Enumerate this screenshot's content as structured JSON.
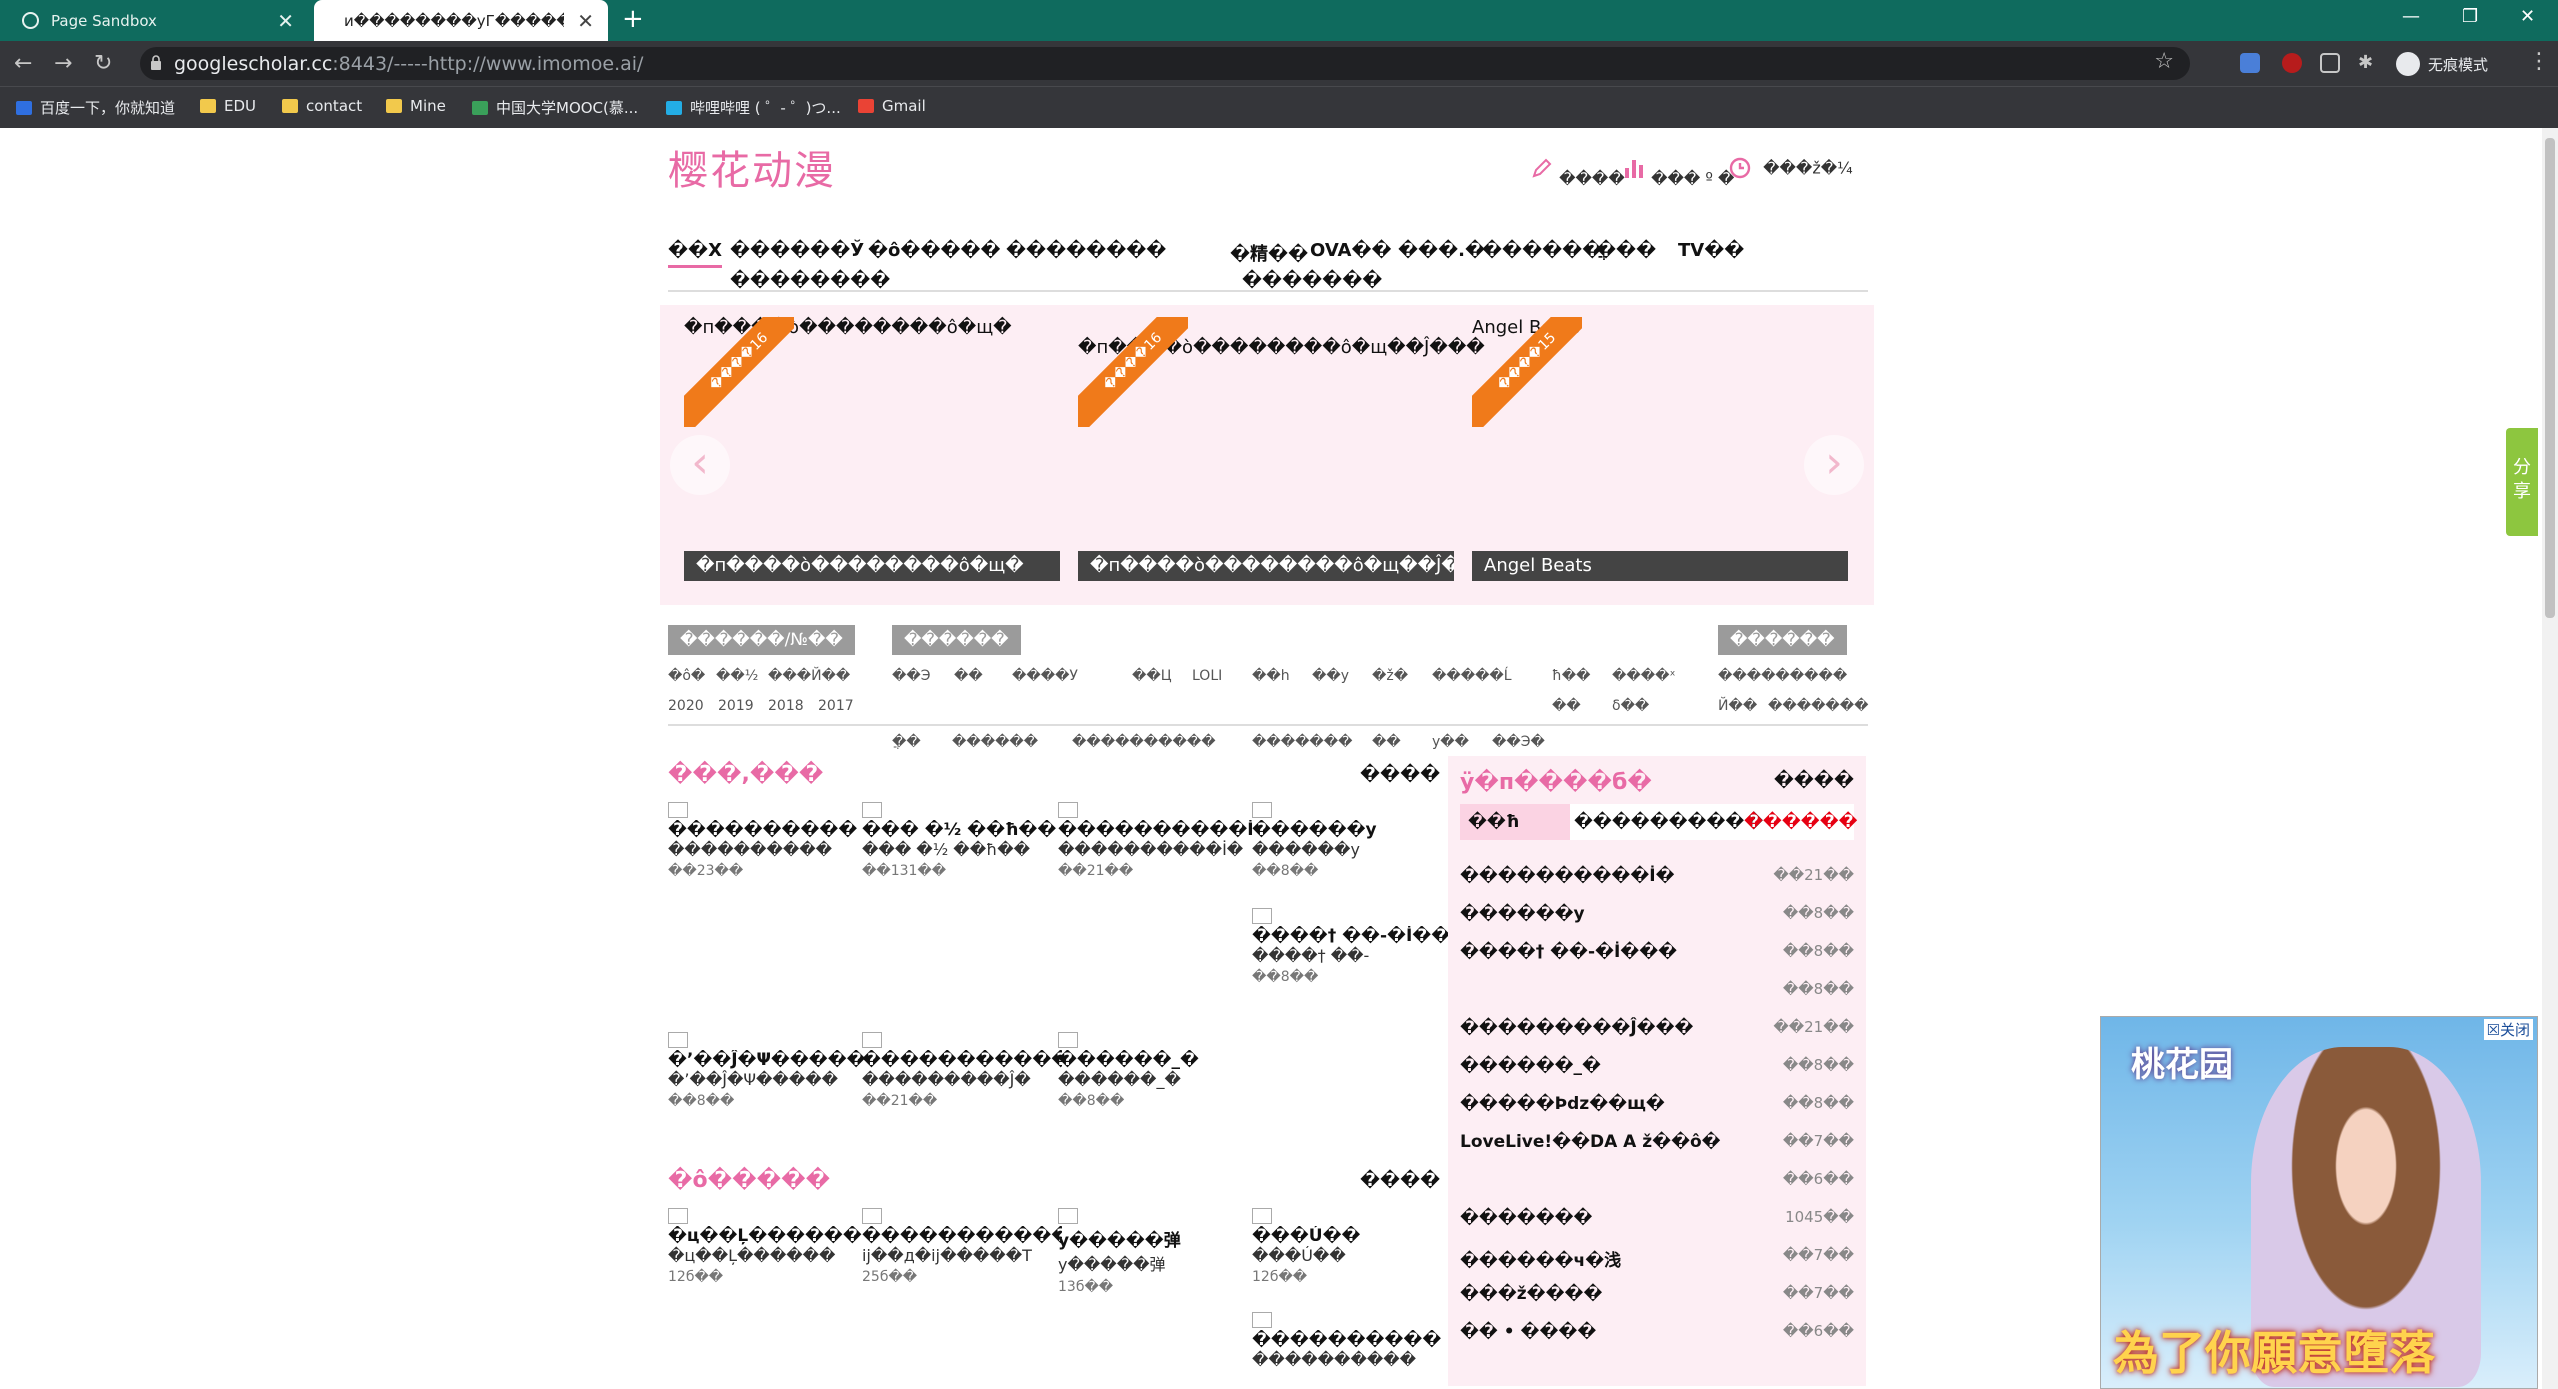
{
  "browser": {
    "tabs": [
      {
        "title": "Page Sandbox",
        "active": false
      },
      {
        "title": "и��������уГ������",
        "active": true
      }
    ],
    "url_host": "googlescholar.cc",
    "url_rest": ":8443/-----http://www.imomoe.ai/",
    "profile_label": "无痕模式",
    "bookmarks": [
      "百度一下，你就知道",
      "EDU",
      "contact",
      "Mine",
      "中国大学MOOC(慕...",
      "哔哩哔哩 ( ゜- ゜)つ...",
      "Gmail"
    ]
  },
  "site": {
    "logo": "樱花动漫",
    "top_icons": [
      {
        "label": "����",
        "icon": "pencil-icon"
      },
      {
        "label": "��� º �",
        "icon": "bar-chart-icon"
      },
      {
        "label": "���ž�¼",
        "icon": "clock-icon"
      }
    ],
    "nav_row1": [
      "��Х",
      "������Ў",
      "�ô�����",
      "��������",
      "�精��",
      "OVA��",
      "���.�",
      "������",
      "�ֲ��",
      "TV��"
    ],
    "nav_row2": [
      "��������",
      "�������"
    ],
    "slides": [
      {
        "alt": "�п����ò��������ô�щ�",
        "caption": "�п����ò��������ô�щ�",
        "ribbon": "����16"
      },
      {
        "alt": "�п����ò��������ô�щ��Ĵ���",
        "caption": "�п����ò��������ô�щ��Ĵ���",
        "ribbon": "����16"
      },
      {
        "alt": "Angel Beats",
        "caption": "Angel Beats",
        "ribbon": "����15"
      }
    ],
    "filters": {
      "head1": "������/№��",
      "head2": "������",
      "head3": "������",
      "years": [
        "2020",
        "2019",
        "2018",
        "2017"
      ],
      "col1_top": [
        "�ô�",
        "��½",
        "���Й��"
      ],
      "col2_top": [
        "��Э",
        "��",
        "����У",
        "��Ц",
        "LOLI",
        "��һ",
        "��у",
        "�ž�",
        "�����Ĺ"
      ],
      "col2_bottom": [
        "�ֲ�",
        "������",
        "����������",
        "�������",
        "��",
        "у��",
        "��Э�"
      ],
      "col3_top": [
        "ħ��",
        "����ˣ"
      ],
      "col3_bottom": [
        "��",
        "δ��"
      ],
      "col4_top": [
        "���������"
      ],
      "col4_bottom": [
        "Й��",
        "�������"
      ]
    },
    "section1": {
      "title": "���,���",
      "more": "����",
      "items": [
        {
          "t1": "����������",
          "t2": "����������",
          "t3": "��23��"
        },
        {
          "t1": "���  �½ ��ħ��",
          "t2": "���  �½ ��ħ��",
          "t3": "��131��"
        },
        {
          "t1": "����������İ�",
          "t2": "����������İ�",
          "t3": "��21��"
        },
        {
          "t1": "������у",
          "t2": "������у",
          "t3": "��8��"
        },
        {
          "t1": "����† ��-�İ���",
          "t2": "����† ��-",
          "t3": "��8��"
        },
        {
          "t1": "�’��Ĵ�Ψ�����",
          "t2": "�’��Ĵ�Ψ�����",
          "t3": "��8��"
        },
        {
          "t1": "�������������",
          "t2": "���������Ĵ�",
          "t3": "��21��"
        },
        {
          "t1": "������_�",
          "t2": "������_�",
          "t3": "��8��"
        }
      ]
    },
    "section2": {
      "title": "�ô�����",
      "more": "����",
      "items": [
        {
          "t1": "�ц��Ļ������",
          "t2": "�ц��Ļ������",
          "t3": "12б��"
        },
        {
          "t1": "��������������",
          "t2": "ĳ��д�ĳ�����Т",
          "t3": "25б��"
        },
        {
          "t1": "у�����弹",
          "t2": "у�����弹",
          "t3": "13б��"
        },
        {
          "t1": "���Ú��",
          "t2": "���Ú��",
          "t3": "12б��"
        },
        {
          "t1": "����������",
          "t2": "����������",
          "t3": ""
        }
      ]
    },
    "ranking": {
      "title": "ÿ�п����б�",
      "more": "����",
      "tabs": [
        "��ħ",
        "����������",
        "������"
      ],
      "rows": [
        {
          "name": "����������İ�",
          "count": "��21��"
        },
        {
          "name": "������у",
          "count": "��8��"
        },
        {
          "name": "����† ��-�İ���",
          "count": "��8��"
        },
        {
          "name": "",
          "count": "��8��"
        },
        {
          "name": "���������Ĵ���",
          "count": "��21��"
        },
        {
          "name": "������_�",
          "count": "��8��"
        },
        {
          "name": "�����Þǳ��щ�",
          "count": "��8��"
        },
        {
          "name": "LoveLive!��DA  A  ž��ô�",
          "count": "��7��"
        },
        {
          "name": "",
          "count": "��6��"
        },
        {
          "name": "�������",
          "count": "1045��"
        },
        {
          "name": "������ч�浅",
          "count": "��7��"
        },
        {
          "name": "���ž����",
          "count": "��7��"
        },
        {
          "name": "�� • ����",
          "count": "��6��"
        }
      ]
    },
    "share_label": "分享",
    "ad": {
      "close": "关闭",
      "logo": "桃花园",
      "slogan": "為了你願意墮落"
    }
  }
}
